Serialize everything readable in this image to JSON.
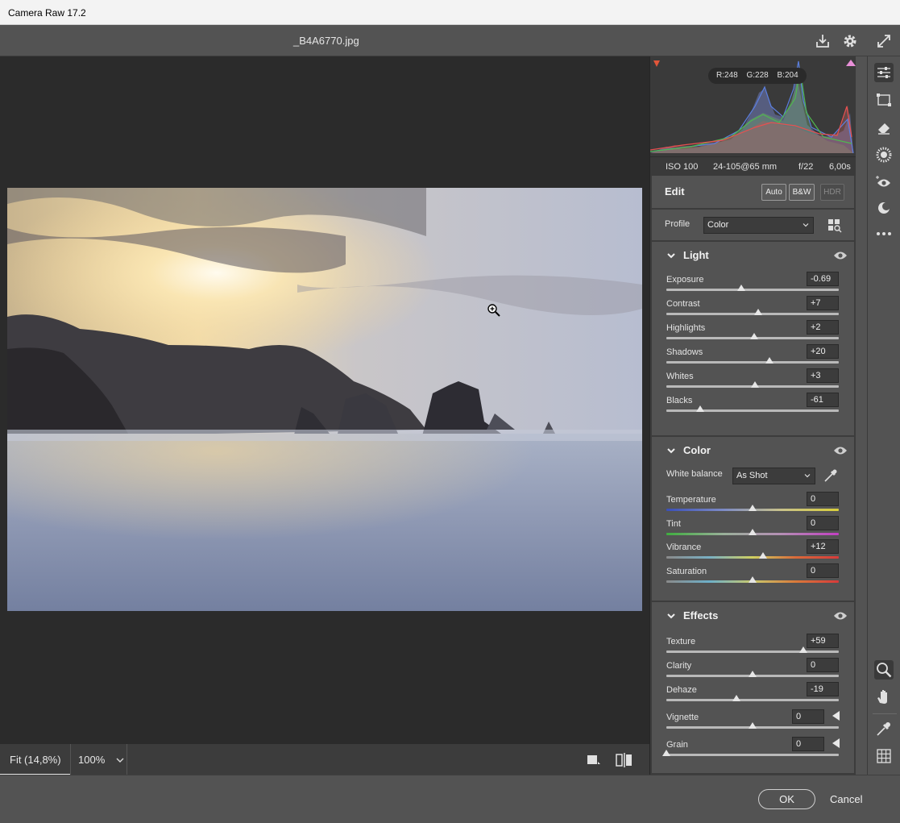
{
  "window": {
    "title": "Camera Raw 17.2"
  },
  "file": {
    "name": "_B4A6770.jpg"
  },
  "histogram": {
    "readout": {
      "r": "R:248",
      "g": "G:228",
      "b": "B:204"
    }
  },
  "meta": {
    "iso": "ISO 100",
    "lens": "24-105@65 mm",
    "aperture": "f/22",
    "shutter": "6,00s"
  },
  "edit": {
    "title": "Edit",
    "auto": "Auto",
    "bw": "B&W",
    "hdr": "HDR",
    "profile_label": "Profile",
    "profile_value": "Color"
  },
  "light": {
    "title": "Light",
    "sliders": [
      {
        "label": "Exposure",
        "value": "-0.69",
        "pos": 0.435
      },
      {
        "label": "Contrast",
        "value": "+7",
        "pos": 0.535
      },
      {
        "label": "Highlights",
        "value": "+2",
        "pos": 0.51
      },
      {
        "label": "Shadows",
        "value": "+20",
        "pos": 0.6
      },
      {
        "label": "Whites",
        "value": "+3",
        "pos": 0.515
      },
      {
        "label": "Blacks",
        "value": "-61",
        "pos": 0.195
      }
    ]
  },
  "color": {
    "title": "Color",
    "wb_label": "White balance",
    "wb_value": "As Shot",
    "sliders": [
      {
        "label": "Temperature",
        "value": "0",
        "pos": 0.5
      },
      {
        "label": "Tint",
        "value": "0",
        "pos": 0.5
      },
      {
        "label": "Vibrance",
        "value": "+12",
        "pos": 0.56
      },
      {
        "label": "Saturation",
        "value": "0",
        "pos": 0.5
      }
    ]
  },
  "effects": {
    "title": "Effects",
    "sliders": [
      {
        "label": "Texture",
        "value": "+59",
        "pos": 0.795
      },
      {
        "label": "Clarity",
        "value": "0",
        "pos": 0.5
      },
      {
        "label": "Dehaze",
        "value": "-19",
        "pos": 0.405
      },
      {
        "label": "Vignette",
        "value": "0",
        "pos": 0.5
      },
      {
        "label": "Grain",
        "value": "0",
        "pos": 0.0
      }
    ]
  },
  "zoom": {
    "fit": "Fit (14,8%)",
    "percent": "100%"
  },
  "footer": {
    "ok": "OK",
    "cancel": "Cancel"
  },
  "colors": {
    "accent_red": "#e2563a",
    "accent_pink": "#e88fd8"
  }
}
